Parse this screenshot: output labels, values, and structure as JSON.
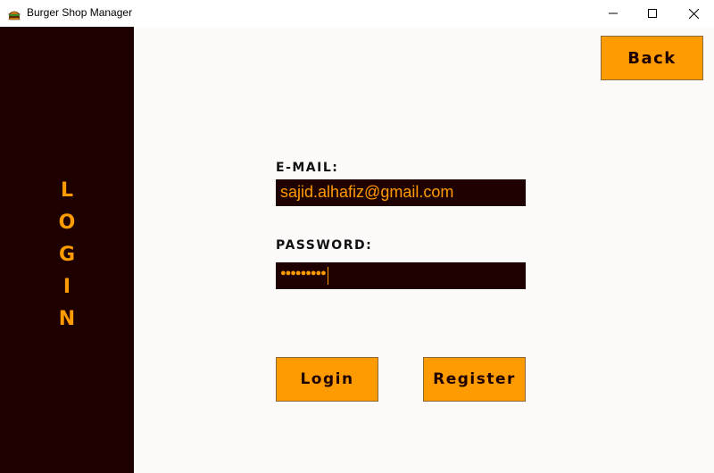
{
  "window": {
    "title": "Burger Shop Manager",
    "icon": "burger-icon",
    "controls": [
      "minimize-icon",
      "maximize-icon",
      "close-icon"
    ]
  },
  "sidebar": {
    "label_letters": [
      "L",
      "O",
      "G",
      "I",
      "N"
    ]
  },
  "header": {
    "back_label": "Back"
  },
  "form": {
    "email_label": "E-MAIL:",
    "email_value": "sajid.alhafiz@gmail.com",
    "password_label": "PASSWORD:",
    "password_masked": "●●●●●●●●●",
    "login_label": "Login",
    "register_label": "Register"
  },
  "colors": {
    "accent": "#fe9b00",
    "dark": "#1f0000",
    "background": "#fdfafa"
  }
}
